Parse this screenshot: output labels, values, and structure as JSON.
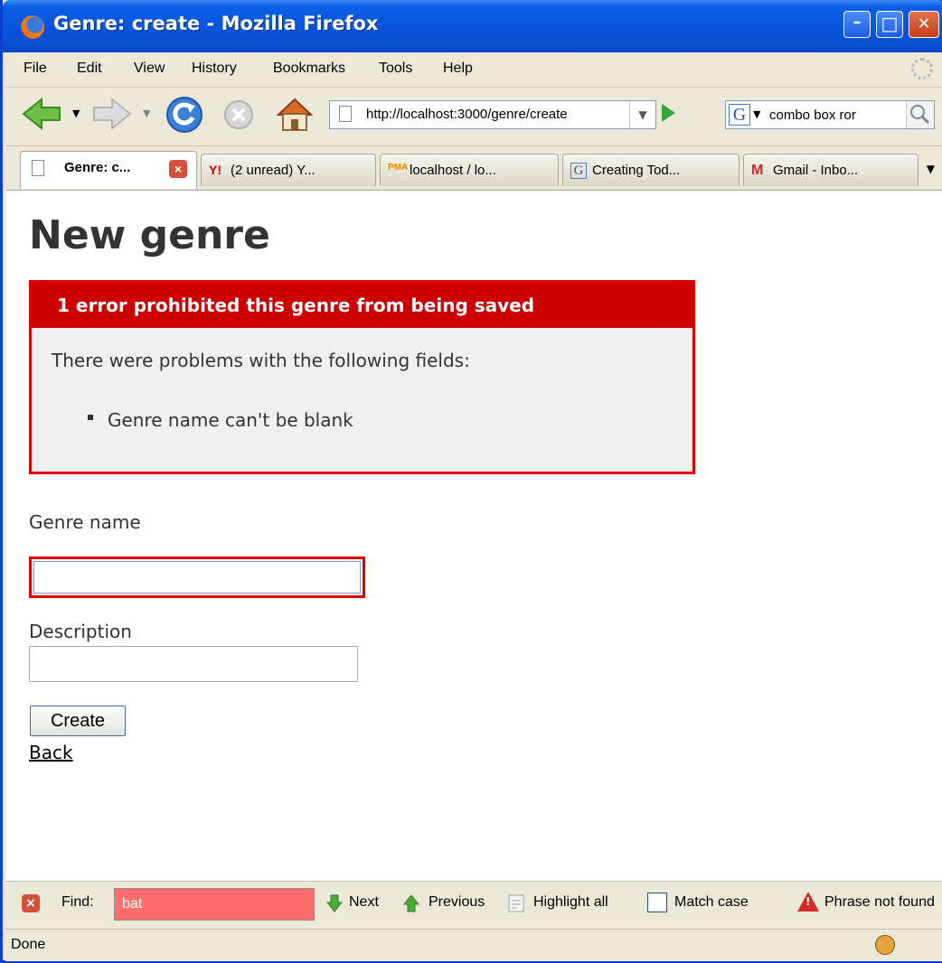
{
  "window": {
    "title": "Genre: create - Mozilla Firefox",
    "minimize_glyph": "–",
    "maximize_glyph": "□",
    "close_glyph": "✕"
  },
  "menubar": {
    "items": [
      {
        "label": "File"
      },
      {
        "label": "Edit"
      },
      {
        "label": "View"
      },
      {
        "label": "History"
      },
      {
        "label": "Bookmarks"
      },
      {
        "label": "Tools"
      },
      {
        "label": "Help"
      }
    ]
  },
  "navbar": {
    "url": "http://localhost:3000/genre/create",
    "search_value": "combo box ror",
    "search_engine_letter": "G"
  },
  "tabs": [
    {
      "label": "Genre: c...",
      "icon": "page-icon",
      "active": true
    },
    {
      "label": "(2 unread) Y...",
      "icon": "yahoo-icon",
      "active": false
    },
    {
      "label": "localhost / lo...",
      "icon": "phpmyadmin-icon",
      "active": false
    },
    {
      "label": "Creating Tod...",
      "icon": "google-icon",
      "active": false
    },
    {
      "label": "Gmail - Inbo...",
      "icon": "gmail-icon",
      "active": false
    }
  ],
  "content": {
    "heading": "New genre",
    "error": {
      "header": "1 error prohibited this genre from being saved",
      "intro": "There were problems with the following fields:",
      "items": [
        "Genre name can't be blank"
      ]
    },
    "form": {
      "genre_name_label": "Genre name",
      "genre_name_value": "",
      "description_label": "Description",
      "description_value": "",
      "create_button": "Create",
      "back_link": "Back"
    }
  },
  "findbar": {
    "find_label": "Find:",
    "find_value": "bat",
    "next_label": "Next",
    "previous_label": "Previous",
    "highlight_label": "Highlight all",
    "match_case_label": "Match case",
    "match_case_checked": false,
    "status_message": "Phrase not found"
  },
  "statusbar": {
    "text": "Done"
  },
  "colors": {
    "error_red": "#cc0000",
    "error_border": "#e00000",
    "find_not_found": "#ff6d6d",
    "xp_titlebar": "#0855dd"
  }
}
